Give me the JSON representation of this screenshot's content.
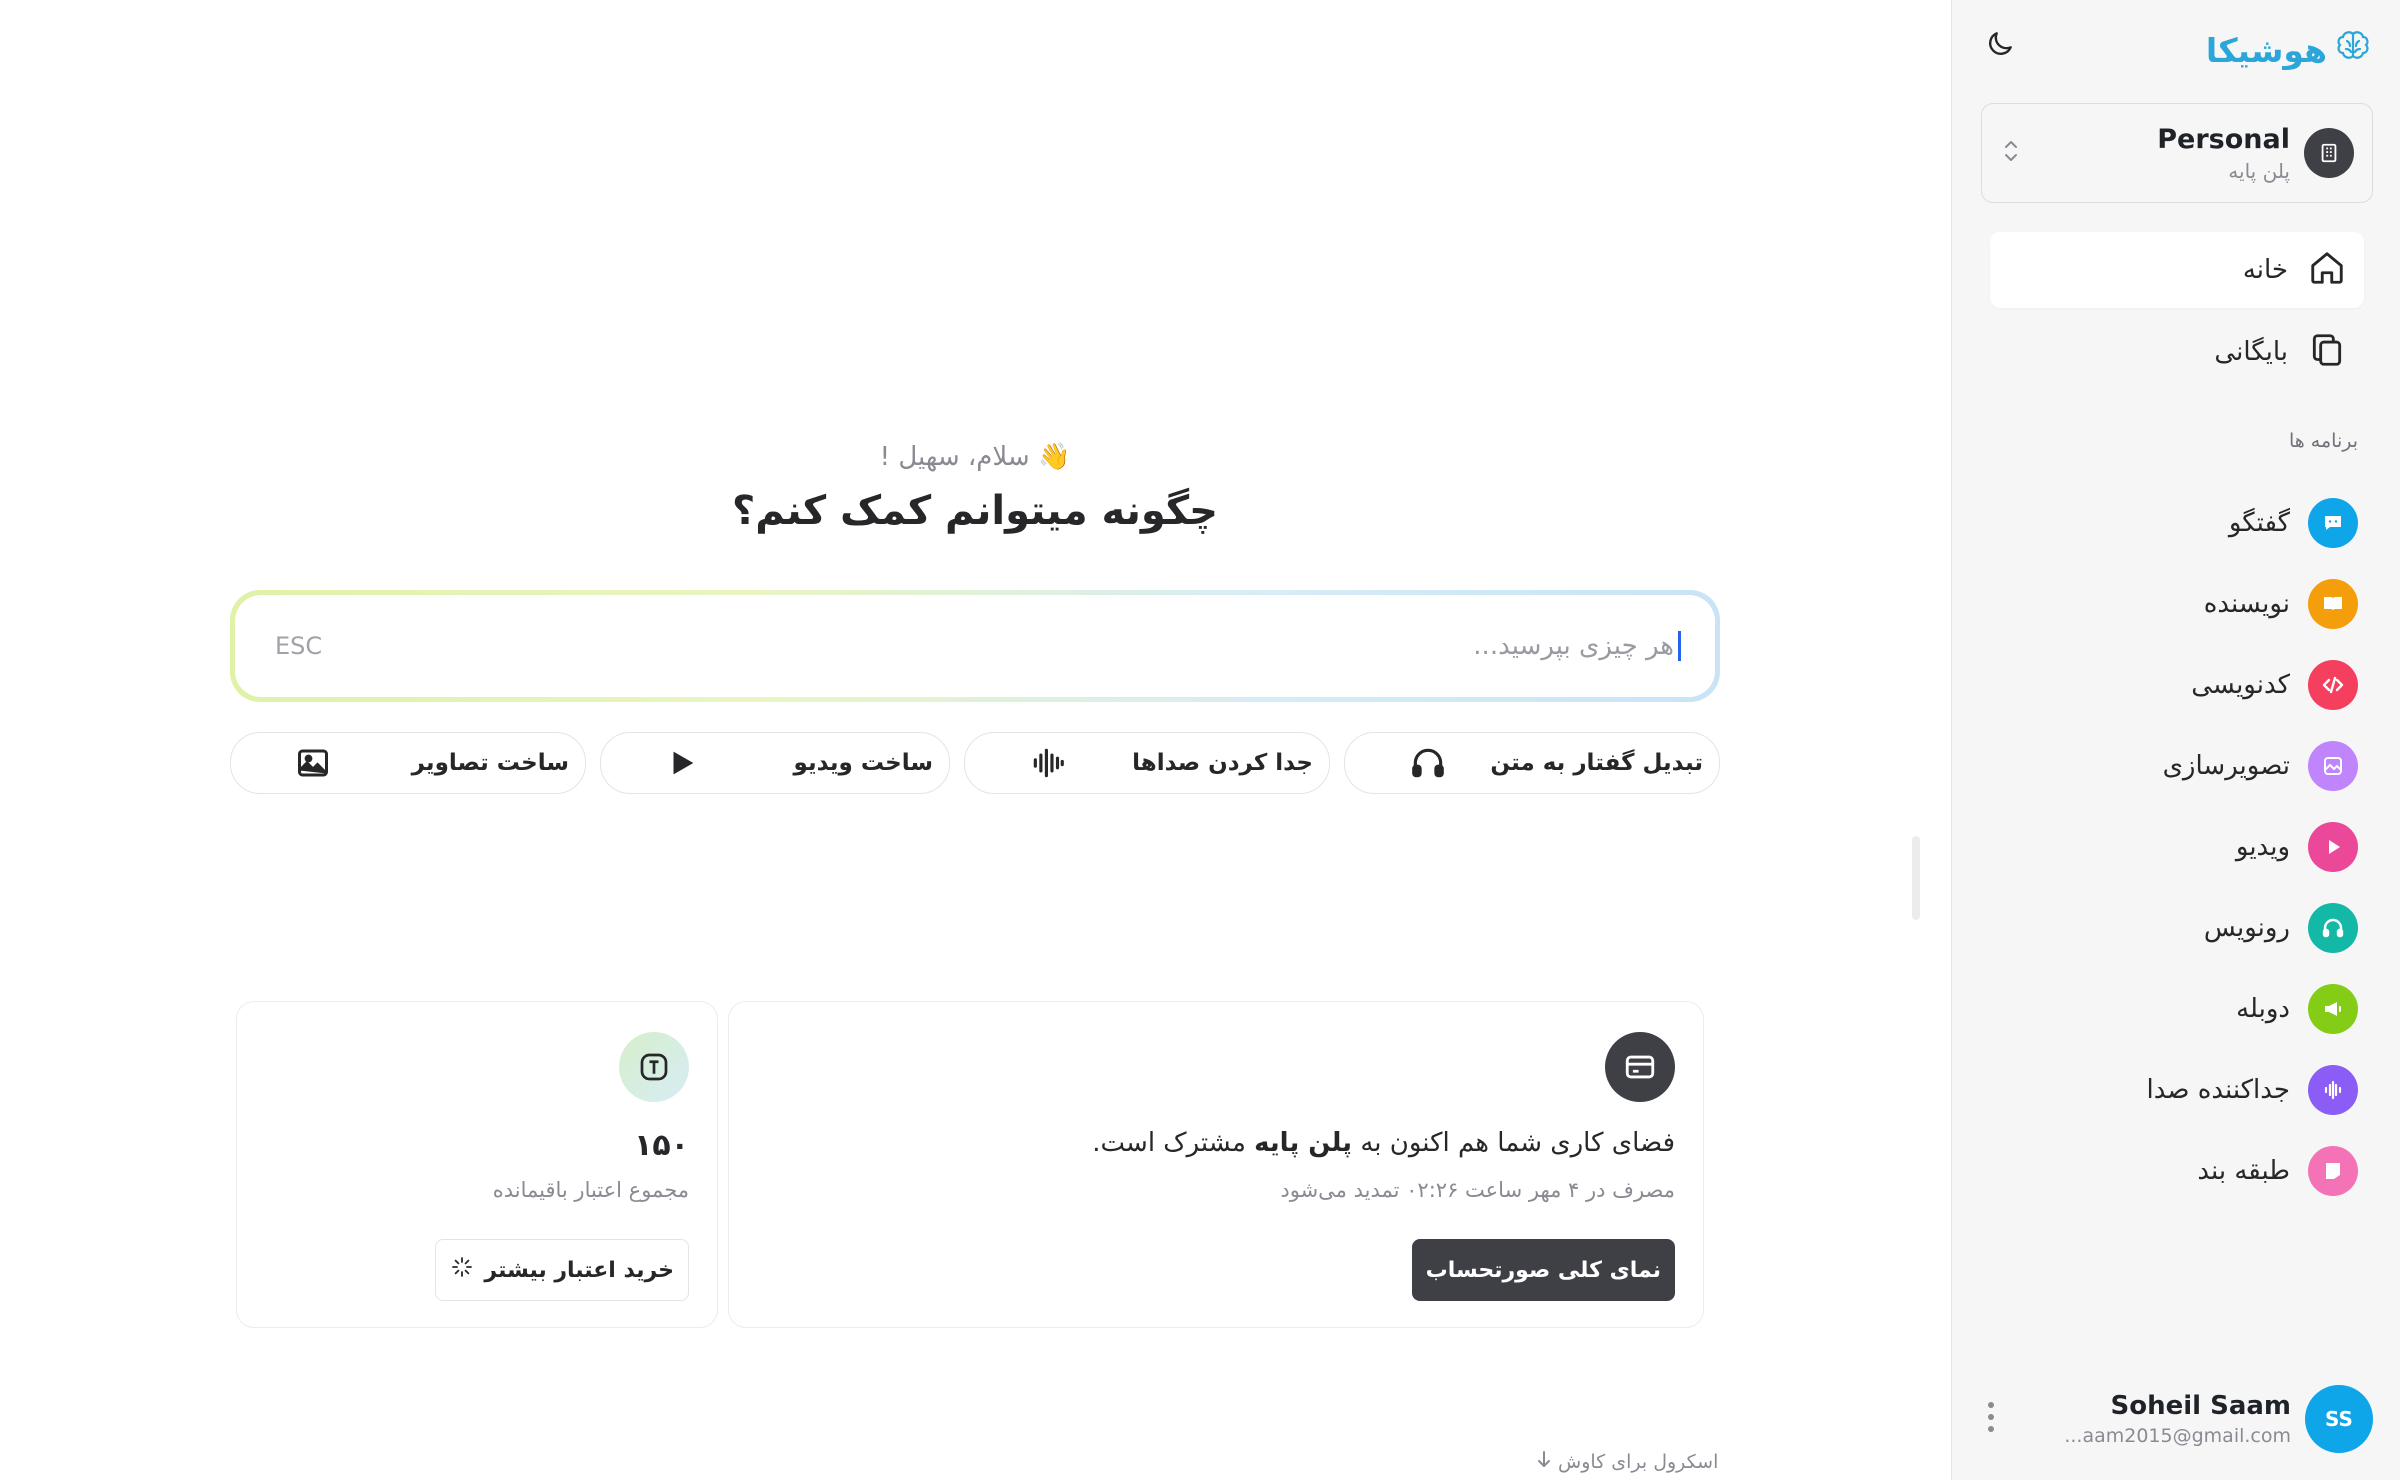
{
  "brand": {
    "name": "هوشیکا",
    "icon": "brain-icon",
    "color": "#2aa7d8"
  },
  "workspace": {
    "name": "Personal",
    "plan": "پلن پایه",
    "icon": "building-icon"
  },
  "nav": [
    {
      "label": "خانه",
      "icon": "home-icon",
      "active": true
    },
    {
      "label": "بایگانی",
      "icon": "copy-icon",
      "active": false
    }
  ],
  "apps": {
    "title": "برنامه ها",
    "items": [
      {
        "label": "گفتگو",
        "icon": "chat-icon",
        "color": "#0ea5e9"
      },
      {
        "label": "نویسنده",
        "icon": "book-icon",
        "color": "#f59e0b"
      },
      {
        "label": "کدنویسی",
        "icon": "code-icon",
        "color": "#f43f5e"
      },
      {
        "label": "تصویرسازی",
        "icon": "image-icon",
        "color": "#c084fc"
      },
      {
        "label": "ویدیو",
        "icon": "play-icon",
        "color": "#ec4899"
      },
      {
        "label": "رونویس",
        "icon": "headphones-icon",
        "color": "#14b8a6"
      },
      {
        "label": "دوبله",
        "icon": "megaphone-icon",
        "color": "#84cc16"
      },
      {
        "label": "جداکننده صدا",
        "icon": "audio-wave-icon",
        "color": "#8b5cf6"
      },
      {
        "label": "طبقه بند",
        "icon": "music-tag-icon",
        "color": "#f472b6"
      }
    ]
  },
  "user": {
    "name": "Soheil Saam",
    "email": "...aam2015@gmail.com",
    "initials": "SS"
  },
  "main": {
    "greeting": "سلام، سهیل !",
    "wave": "👋",
    "headline": "چگونه میتوانم کمک کنم؟",
    "search": {
      "placeholder": "هر چیزی بپرسید...",
      "hint": "ESC"
    },
    "quick_actions": [
      {
        "label": "تبدیل گفتار به متن",
        "icon": "headphones-icon"
      },
      {
        "label": "جدا کردن صداها",
        "icon": "audio-wave-icon"
      },
      {
        "label": "ساخت ویدیو",
        "icon": "play-icon"
      },
      {
        "label": "ساخت تصاویر",
        "icon": "image-icon"
      }
    ],
    "plan_card": {
      "text_before": "فضای کاری شما هم اکنون به",
      "plan_name": "پلن پایه",
      "text_after": "مشترک است.",
      "renewal": "مصرف در ۴ مهر ساعت ۰۲:۲۶ تمدید می‌شود",
      "button": "نمای کلی صورتحساب"
    },
    "credit_card": {
      "value": "۱۵۰",
      "label": "مجموع اعتبار باقیمانده",
      "button": "خرید اعتبار بیشتر"
    },
    "scroll_hint": "اسکرول برای کاوش"
  }
}
